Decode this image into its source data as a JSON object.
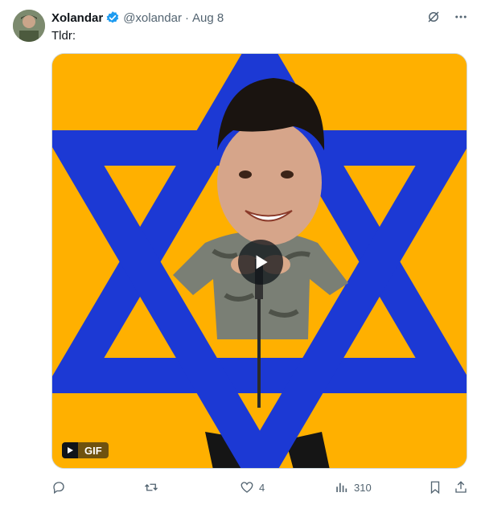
{
  "tweet": {
    "author_name": "Xolandar",
    "handle": "@xolandar",
    "separator": "·",
    "date": "Aug 8",
    "text": "Tldr:",
    "media": {
      "badge_label": "GIF",
      "colors": {
        "background": "#ffb000",
        "star": "#1c39d4",
        "shirt": "#7a7f75"
      }
    },
    "actions": {
      "reply_count": "",
      "retweet_count": "",
      "like_count": "4",
      "views_count": "310"
    },
    "icons": {
      "verified": "verified-badge-icon",
      "grok": "grok-icon",
      "more": "more-icon",
      "reply": "reply-icon",
      "retweet": "retweet-icon",
      "like": "heart-icon",
      "views": "views-icon",
      "bookmark": "bookmark-icon",
      "share": "share-icon"
    }
  }
}
